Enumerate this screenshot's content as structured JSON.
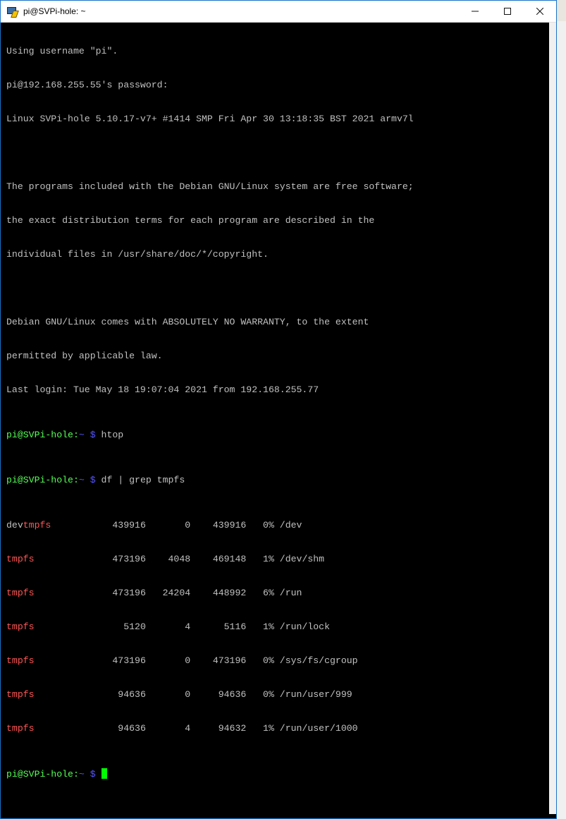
{
  "window": {
    "title": "pi@SVPi-hole: ~",
    "minimize_icon": "minimize-icon",
    "maximize_icon": "maximize-icon",
    "close_icon": "close-icon"
  },
  "colors": {
    "prompt_user": "#55ff55",
    "prompt_path": "#5555ff",
    "device_name": "#ff5555",
    "text": "#c0c0c0",
    "background": "#000000",
    "cursor": "#00ff00"
  },
  "terminal": {
    "intro": [
      "Using username \"pi\".",
      "pi@192.168.255.55's password:",
      "Linux SVPi-hole 5.10.17-v7+ #1414 SMP Fri Apr 30 13:18:35 BST 2021 armv7l",
      "",
      "The programs included with the Debian GNU/Linux system are free software;",
      "the exact distribution terms for each program are described in the",
      "individual files in /usr/share/doc/*/copyright.",
      "",
      "Debian GNU/Linux comes with ABSOLUTELY NO WARRANTY, to the extent",
      "permitted by applicable law.",
      "Last login: Tue May 18 19:07:04 2021 from 192.168.255.77"
    ],
    "prompt": {
      "user_host": "pi@SVPi-hole",
      "path": ":~ $ ",
      "colon": ":",
      "tilde_dollar": "~ $ "
    },
    "commands": [
      "htop",
      "df | grep tmpfs"
    ],
    "df_rows": [
      {
        "prefix": "dev",
        "fs": "tmpfs",
        "rest": "           439916       0    439916   0% /dev"
      },
      {
        "prefix": "",
        "fs": "tmpfs",
        "rest": "              473196    4048    469148   1% /dev/shm"
      },
      {
        "prefix": "",
        "fs": "tmpfs",
        "rest": "              473196   24204    448992   6% /run"
      },
      {
        "prefix": "",
        "fs": "tmpfs",
        "rest": "                5120       4      5116   1% /run/lock"
      },
      {
        "prefix": "",
        "fs": "tmpfs",
        "rest": "              473196       0    473196   0% /sys/fs/cgroup"
      },
      {
        "prefix": "",
        "fs": "tmpfs",
        "rest": "               94636       0     94636   0% /run/user/999"
      },
      {
        "prefix": "",
        "fs": "tmpfs",
        "rest": "               94636       4     94632   1% /run/user/1000"
      }
    ]
  }
}
